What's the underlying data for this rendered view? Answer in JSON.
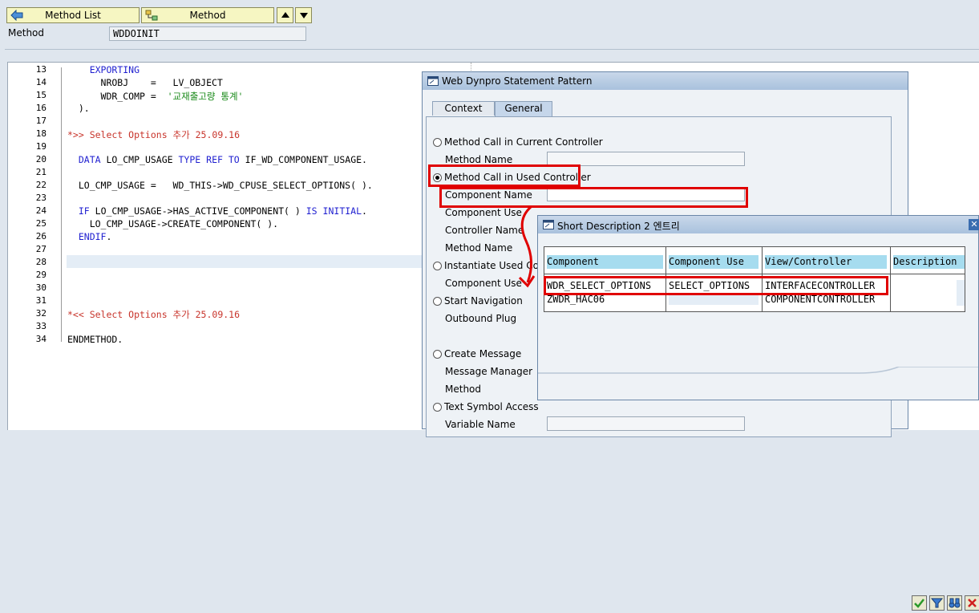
{
  "toolbar": {
    "method_list_label": "Method List",
    "method_label": "Method",
    "up_icon": "triangle-up-icon",
    "down_icon": "triangle-down-icon"
  },
  "header": {
    "method_field_label": "Method",
    "method_field_value": "WDDOINIT"
  },
  "editor": {
    "lines": [
      {
        "num": "13",
        "code": "    EXPORTING"
      },
      {
        "num": "14",
        "code": "      NROBJ    =   LV_OBJECT"
      },
      {
        "num": "15",
        "code": "      WDR_COMP =  '교재출고량 통계'"
      },
      {
        "num": "16",
        "code": "  )."
      },
      {
        "num": "17",
        "code": ""
      },
      {
        "num": "18",
        "code": "*>> Select Options 추가 25.09.16"
      },
      {
        "num": "19",
        "code": ""
      },
      {
        "num": "20",
        "code": "  DATA LO_CMP_USAGE TYPE REF TO IF_WD_COMPONENT_USAGE."
      },
      {
        "num": "21",
        "code": ""
      },
      {
        "num": "22",
        "code": "  LO_CMP_USAGE =   WD_THIS->WD_CPUSE_SELECT_OPTIONS( )."
      },
      {
        "num": "23",
        "code": ""
      },
      {
        "num": "24",
        "code": "  IF LO_CMP_USAGE->HAS_ACTIVE_COMPONENT( ) IS INITIAL."
      },
      {
        "num": "25",
        "code": "    LO_CMP_USAGE->CREATE_COMPONENT( )."
      },
      {
        "num": "26",
        "code": "  ENDIF."
      },
      {
        "num": "27",
        "code": ""
      },
      {
        "num": "28",
        "code": ""
      },
      {
        "num": "29",
        "code": ""
      },
      {
        "num": "30",
        "code": ""
      },
      {
        "num": "31",
        "code": ""
      },
      {
        "num": "32",
        "code": "*<< Select Options 추가 25.09.16"
      },
      {
        "num": "33",
        "code": ""
      },
      {
        "num": "34",
        "code": "ENDMETHOD."
      }
    ]
  },
  "wd_dialog": {
    "title": "Web Dynpro Statement Pattern",
    "tabs": [
      "Context",
      "General"
    ],
    "active_tab": "General",
    "options": {
      "current_controller": "Method Call in Current Controller",
      "method_name_1": "Method Name",
      "used_controller": "Method Call in Used Controller",
      "component_name": "Component Name",
      "component_use": "Component Use",
      "controller_name": "Controller Name",
      "method_name_2": "Method Name",
      "instantiate": "Instantiate Used Com",
      "component_use_2": "Component Use",
      "start_nav": "Start Navigation",
      "outbound_plug": "Outbound Plug",
      "create_message": "Create Message",
      "message_manager": "Message Manager",
      "method": "Method",
      "text_symbol": "Text Symbol Access",
      "variable_name": "Variable Name"
    }
  },
  "sd_dialog": {
    "title": "Short Description 2 엔트리",
    "columns": [
      "Component",
      "Component Use",
      "View/Controller",
      "Description"
    ],
    "rows": [
      [
        "WDR_SELECT_OPTIONS",
        "SELECT_OPTIONS",
        "INTERFACECONTROLLER",
        ""
      ],
      [
        "ZWDR_HAC06",
        "",
        "COMPONENTCONTROLLER",
        ""
      ]
    ],
    "buttons": [
      "check-icon",
      "filter-icon",
      "binoculars-icon",
      "cancel-icon"
    ]
  }
}
